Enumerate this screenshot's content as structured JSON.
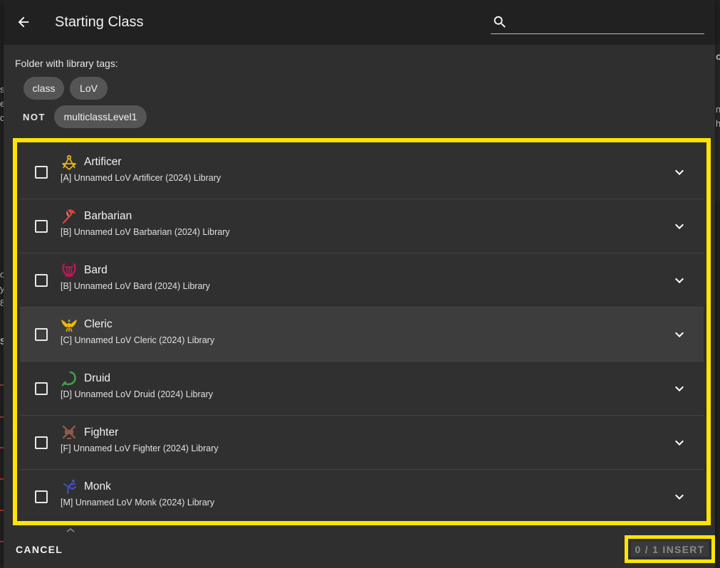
{
  "header": {
    "title": "Starting Class",
    "search_placeholder": ""
  },
  "filter": {
    "label": "Folder with library tags:",
    "include_tags": [
      "class",
      "LoV"
    ],
    "not_label": "NOT",
    "exclude_tags": [
      "multiclassLevel1"
    ]
  },
  "items": [
    {
      "name": "Artificer",
      "library": "[A] Unnamed LoV Artificer (2024) Library",
      "icon": "artificer-compass-icon",
      "icon_color": "#e8b51d",
      "checked": false
    },
    {
      "name": "Barbarian",
      "library": "[B] Unnamed LoV Barbarian (2024) Library",
      "icon": "barbarian-axe-icon",
      "icon_color": "#d64541",
      "checked": false
    },
    {
      "name": "Bard",
      "library": "[B] Unnamed LoV Bard (2024) Library",
      "icon": "bard-lyre-icon",
      "icon_color": "#c2185b",
      "checked": false
    },
    {
      "name": "Cleric",
      "library": "[C] Unnamed LoV Cleric (2024) Library",
      "icon": "cleric-winged-sun-icon",
      "icon_color": "#f2b705",
      "checked": false
    },
    {
      "name": "Druid",
      "library": "[D] Unnamed LoV Druid (2024) Library",
      "icon": "druid-sickle-icon",
      "icon_color": "#43a047",
      "checked": false
    },
    {
      "name": "Fighter",
      "library": "[F] Unnamed LoV Fighter (2024) Library",
      "icon": "fighter-swords-icon",
      "icon_color": "#8d5a4a",
      "checked": false
    },
    {
      "name": "Monk",
      "library": "[M] Unnamed LoV Monk (2024) Library",
      "icon": "monk-kick-icon",
      "icon_color": "#3f51b5",
      "checked": false
    }
  ],
  "footer": {
    "cancel_label": "CANCEL",
    "insert_label": "0 / 1 INSERT"
  },
  "colors": {
    "highlight": "#ffe400",
    "dialog_bg": "#2f2f2f",
    "header_bg": "#212121"
  }
}
